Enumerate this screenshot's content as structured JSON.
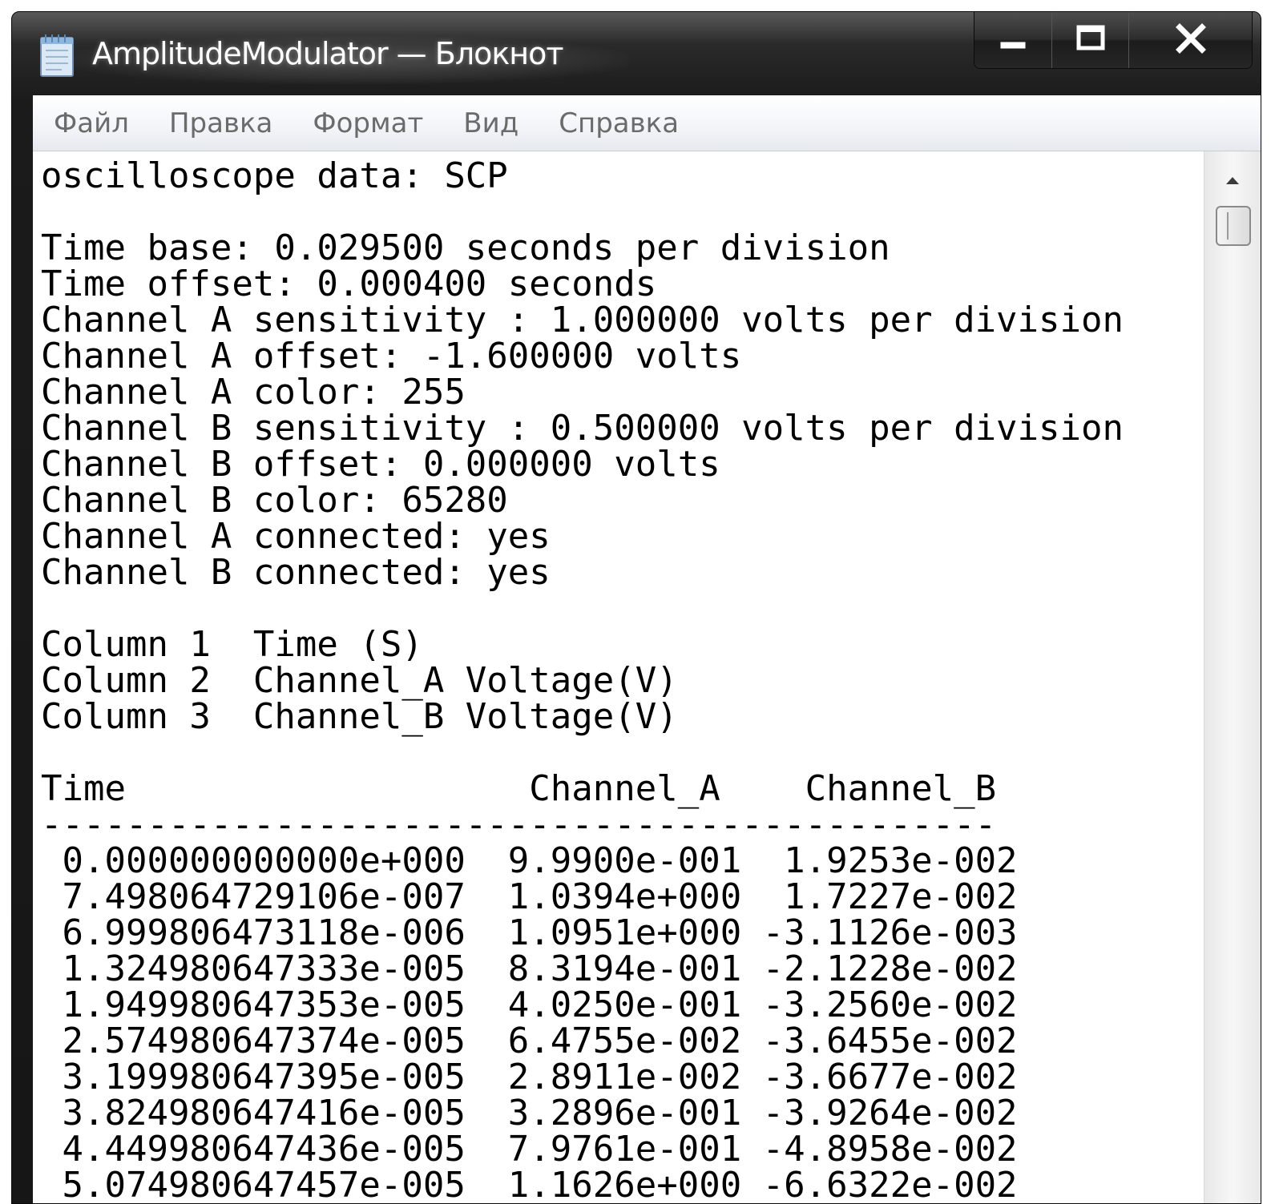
{
  "window": {
    "title": "AmplitudeModulator — Блокнот",
    "icon": "notepad-icon"
  },
  "caption_buttons": {
    "minimize_icon": "minimize-icon",
    "maximize_icon": "maximize-icon",
    "close_icon": "close-icon"
  },
  "menu": {
    "items": [
      {
        "label": "Файл"
      },
      {
        "label": "Правка"
      },
      {
        "label": "Формат"
      },
      {
        "label": "Вид"
      },
      {
        "label": "Справка"
      }
    ]
  },
  "document": {
    "text": "oscilloscope data: SCP\n\nTime base: 0.029500 seconds per division\nTime offset: 0.000400 seconds\nChannel A sensitivity : 1.000000 volts per division\nChannel A offset: -1.600000 volts\nChannel A color: 255\nChannel B sensitivity : 0.500000 volts per division\nChannel B offset: 0.000000 volts\nChannel B color: 65280\nChannel A connected: yes\nChannel B connected: yes\n\nColumn 1  Time (S)\nColumn 2  Channel_A Voltage(V)\nColumn 3  Channel_B Voltage(V)\n\nTime                   Channel_A    Channel_B\n---------------------------------------------\n 0.000000000000e+000  9.9900e-001  1.9253e-002\n 7.498064729106e-007  1.0394e+000  1.7227e-002\n 6.999806473118e-006  1.0951e+000 -3.1126e-003\n 1.324980647333e-005  8.3194e-001 -2.1228e-002\n 1.949980647353e-005  4.0250e-001 -3.2560e-002\n 2.574980647374e-005  6.4755e-002 -3.6455e-002\n 3.199980647395e-005  2.8911e-002 -3.6677e-002\n 3.824980647416e-005  3.2896e-001 -3.9264e-002\n 4.449980647436e-005  7.9761e-001 -4.8958e-002\n 5.074980647457e-005  1.1626e+000 -6.6322e-002"
  },
  "colors": {
    "frame_dark": "#1b1b1b",
    "menu_text": "#6b6b6b",
    "editor_bg": "#ffffff",
    "text": "#000000"
  }
}
